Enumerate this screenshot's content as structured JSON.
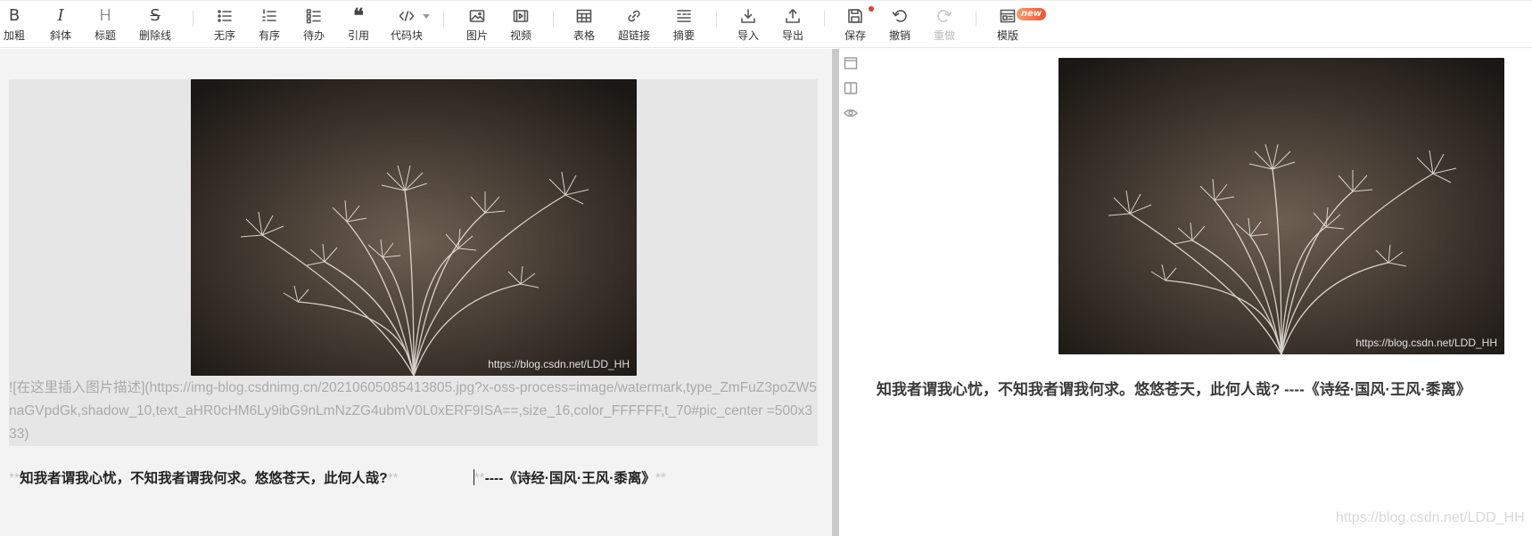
{
  "toolbar": {
    "bold": "加粗",
    "italic": "斜体",
    "heading": "标题",
    "strike": "删除线",
    "ul": "无序",
    "ol": "有序",
    "todo": "待办",
    "quote": "引用",
    "code": "代码块",
    "image": "图片",
    "video": "视频",
    "table": "表格",
    "link": "超链接",
    "summary": "摘要",
    "import": "导入",
    "export": "导出",
    "save": "保存",
    "undo": "撤销",
    "redo": "重做",
    "template": "模版",
    "template_badge": "new"
  },
  "editor": {
    "image_watermark": "https://blog.csdn.net/LDD_HH",
    "markdown_source": "![在这里插入图片描述](https://img-blog.csdnimg.cn/20210605085413805.jpg?x-oss-process=image/watermark,type_ZmFuZ3poZW5naGVpdGk,shadow_10,text_aHR0cHM6Ly9ibG9nLmNzZG4ubmV0L0xERF9ISA==,size_16,color_FFFFFF,t_70#pic_center =500x333)",
    "bold_mark": "**",
    "line_part1": "知我者谓我心忧，不知我者谓我何求。悠悠苍天，此何人哉?",
    "line_part2": "----《诗经·国风·王风·黍离》"
  },
  "preview": {
    "image_watermark": "https://blog.csdn.net/LDD_HH",
    "quote": "知我者谓我心忧，不知我者谓我何求。悠悠苍天，此何人哉? ----《诗经·国风·王风·黍离》"
  },
  "page_watermark": "https://blog.csdn.net/LDD_HH"
}
